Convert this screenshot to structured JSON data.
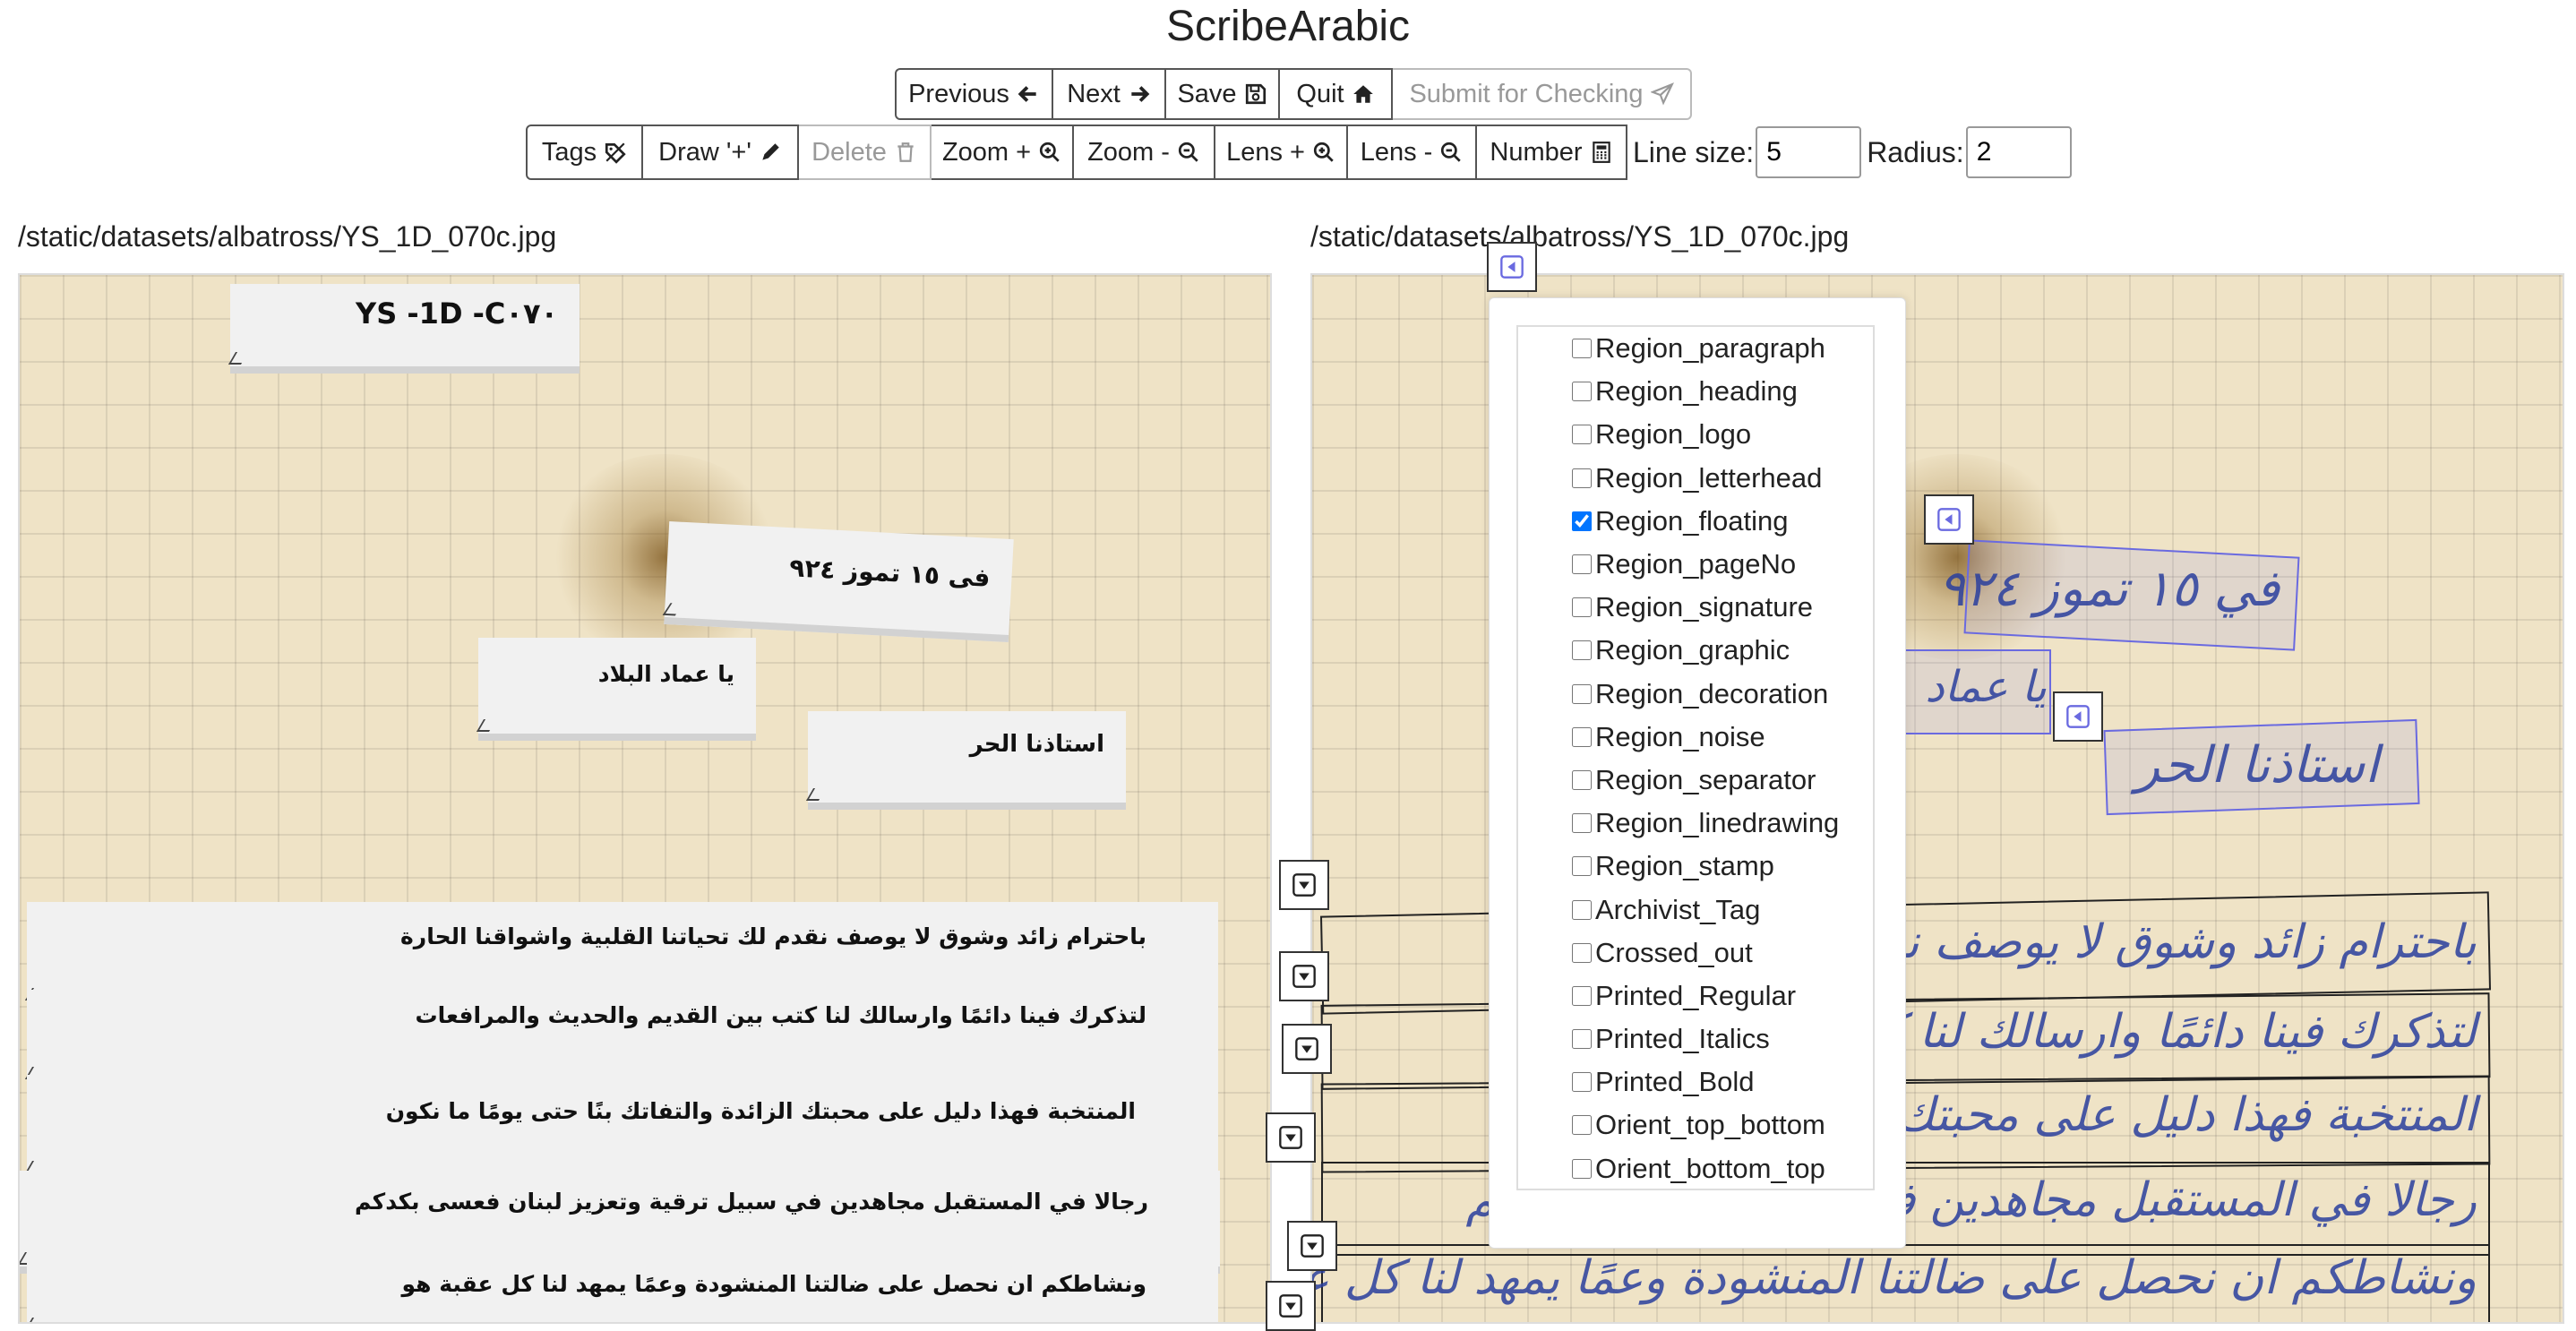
{
  "app": {
    "title": "ScribeArabic"
  },
  "nav": {
    "previous": "Previous",
    "next": "Next",
    "save": "Save",
    "quit": "Quit",
    "submit": "Submit for Checking"
  },
  "tools": {
    "tags": "Tags",
    "draw": "Draw '+'",
    "delete": "Delete",
    "zoom_in": "Zoom +",
    "zoom_out": "Zoom -",
    "lens_in": "Lens +",
    "lens_out": "Lens -",
    "number": "Number",
    "line_size_label": "Line size:",
    "line_size_value": "5",
    "radius_label": "Radius:",
    "radius_value": "2"
  },
  "left_panel": {
    "path": "/static/datasets/albatross/YS_1D_070c.jpg",
    "header_text": "YS -1D -C٠٧٠",
    "date_text": "فی ١٥ تموز ٩٢٤",
    "greeting_text": "يا عماد البلاد",
    "teacher_text": "استاذنا الحر",
    "lines": [
      "باحترام زائد وشوق لا يوصف نقدم لك تحياتنا القلبية واشواقنا الحارة",
      "لتذكرك فينا دائمًا وارسالك لنا كتب بين القديم والحديث والمرافعات",
      "المنتخبة فهذا دليل على محبتك الزائدة والتفاتك بنًا حتى يومًا ما نكون",
      "رجالا في المستقبل مجاهدين في سبيل ترقية وتعزيز لبنان فعسى بكدكم",
      "ونشاطكم ان نحصل على ضالتنا المنشودة وعمًا يمهد لنا كل عقبة هو"
    ]
  },
  "right_panel": {
    "path": "/static/datasets/albatross/YS_1D_070c.jpg",
    "date_script": "في ١٥ تموز ٩٢٤",
    "greeting_script": "يا عماد",
    "teacher_script": "استاذنا الحر",
    "script_lines": [
      "باحترام زائد وشوق لا يوصف نقدم لك تحياتنا الحارة",
      "لتذكرك فينا دائمًا وارسالك لنا كتب والمرافعات",
      "المنتخبة فهذا دليل على محبتك الزائدة ما نكون",
      "رجالا في المستقبل مجاهدين في سبيل فعسى بكدكم",
      "ونشاطكم ان نحصل على ضالتنا المنشودة وعمًا يمهد لنا كل عقبة هو"
    ]
  },
  "tags": [
    {
      "label": "Region_paragraph",
      "checked": false
    },
    {
      "label": "Region_heading",
      "checked": false
    },
    {
      "label": "Region_logo",
      "checked": false
    },
    {
      "label": "Region_letterhead",
      "checked": false
    },
    {
      "label": "Region_floating",
      "checked": true
    },
    {
      "label": "Region_pageNo",
      "checked": false
    },
    {
      "label": "Region_signature",
      "checked": false
    },
    {
      "label": "Region_graphic",
      "checked": false
    },
    {
      "label": "Region_decoration",
      "checked": false
    },
    {
      "label": "Region_noise",
      "checked": false
    },
    {
      "label": "Region_separator",
      "checked": false
    },
    {
      "label": "Region_linedrawing",
      "checked": false
    },
    {
      "label": "Region_stamp",
      "checked": false
    },
    {
      "label": "Archivist_Tag",
      "checked": false
    },
    {
      "label": "Crossed_out",
      "checked": false
    },
    {
      "label": "Printed_Regular",
      "checked": false
    },
    {
      "label": "Printed_Italics",
      "checked": false
    },
    {
      "label": "Printed_Bold",
      "checked": false
    },
    {
      "label": "Orient_top_bottom",
      "checked": false
    },
    {
      "label": "Orient_bottom_top",
      "checked": false
    }
  ],
  "icons": {
    "previous": "arrow-left-icon",
    "next": "arrow-right-icon",
    "save": "floppy-icon",
    "quit": "home-icon",
    "submit": "send-icon",
    "tags": "tag-icon",
    "draw": "pencil-icon",
    "delete": "trash-icon",
    "zoom_in": "zoom-in-icon",
    "zoom_out": "zoom-out-icon",
    "lens_in": "zoom-in-icon",
    "lens_out": "zoom-out-icon",
    "number": "calculator-icon"
  },
  "colors": {
    "paper": "#efe3c6",
    "ink": "#2a3f9e",
    "region_blue": "#6a6ae0",
    "disabled": "#999999"
  }
}
